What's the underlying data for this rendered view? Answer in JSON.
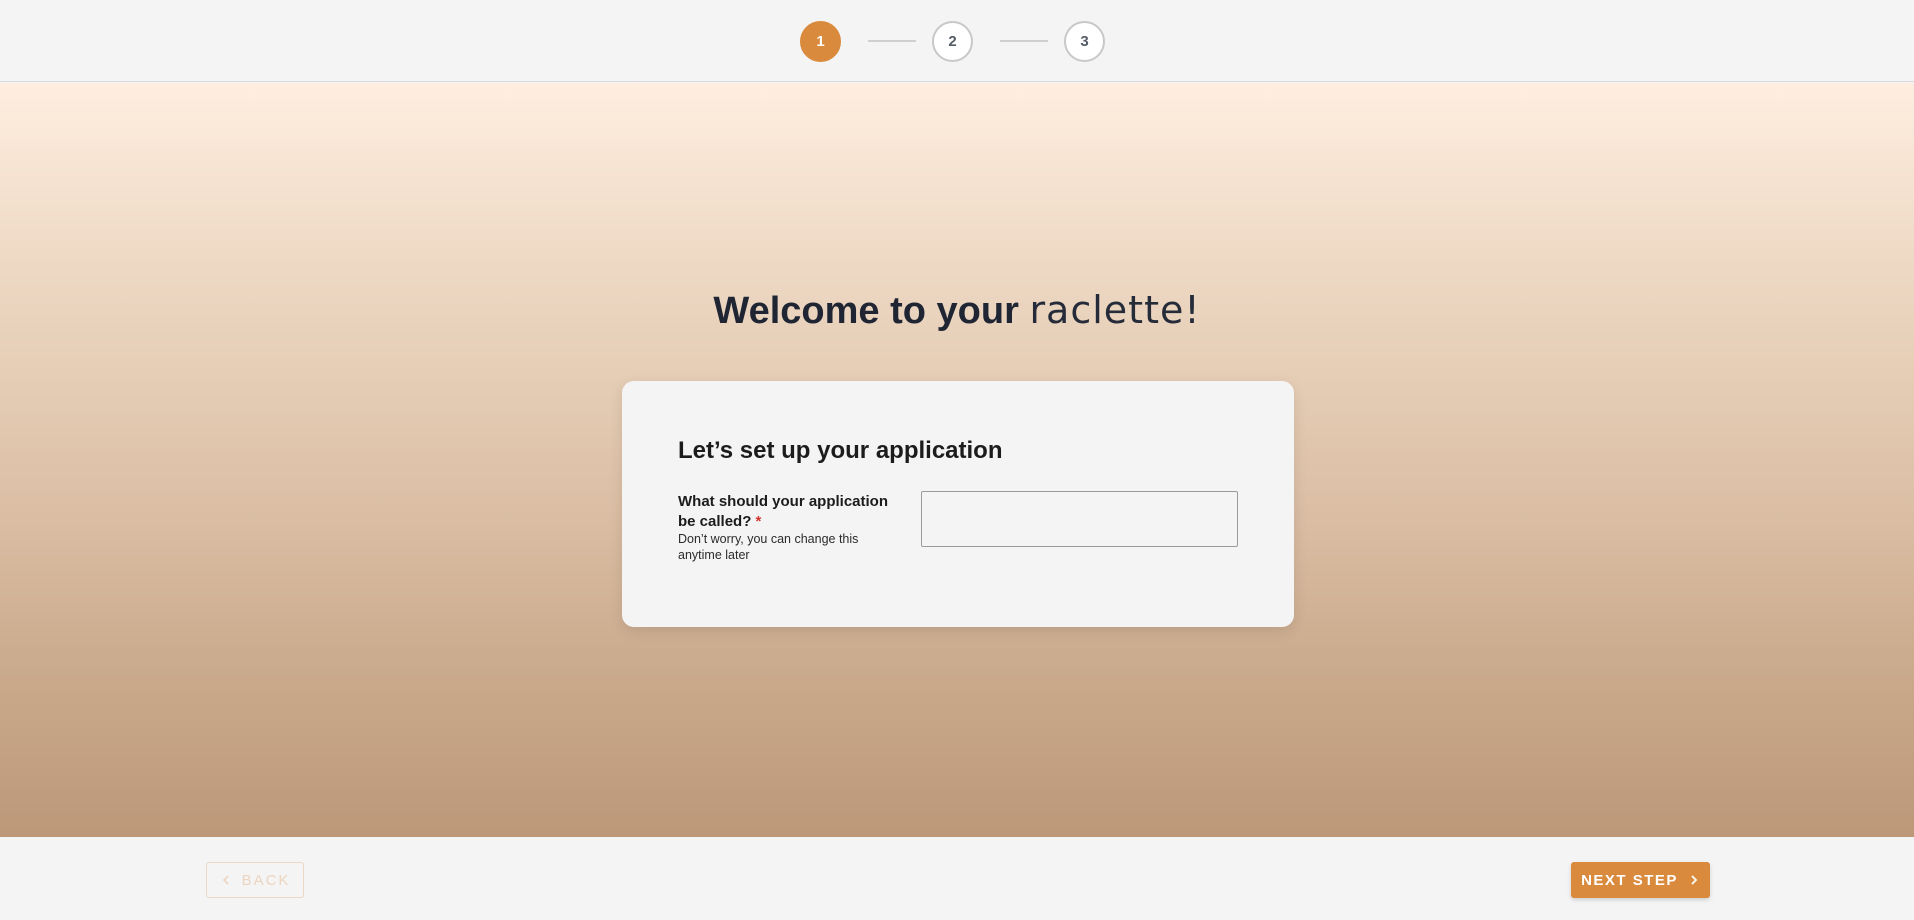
{
  "stepper": {
    "steps": [
      {
        "label": "1",
        "state": "active"
      },
      {
        "label": "2",
        "state": "inactive"
      },
      {
        "label": "3",
        "state": "inactive"
      }
    ]
  },
  "welcome": {
    "prefix": "Welcome to your ",
    "brand": "raclette!"
  },
  "card": {
    "title": "Let’s set up your application",
    "field_label": "What should your application be called?",
    "required_mark": "*",
    "field_help": "Don’t worry, you can change this anytime later",
    "input_value": "",
    "input_placeholder": ""
  },
  "footer": {
    "back_label": "BACK",
    "next_label": "NEXT STEP"
  },
  "icons": {
    "back": "chevron-left-icon",
    "next": "chevron-right-icon"
  },
  "colors": {
    "accent": "#d98a3d",
    "required": "#d0342c",
    "text_dark": "#1f2533"
  }
}
